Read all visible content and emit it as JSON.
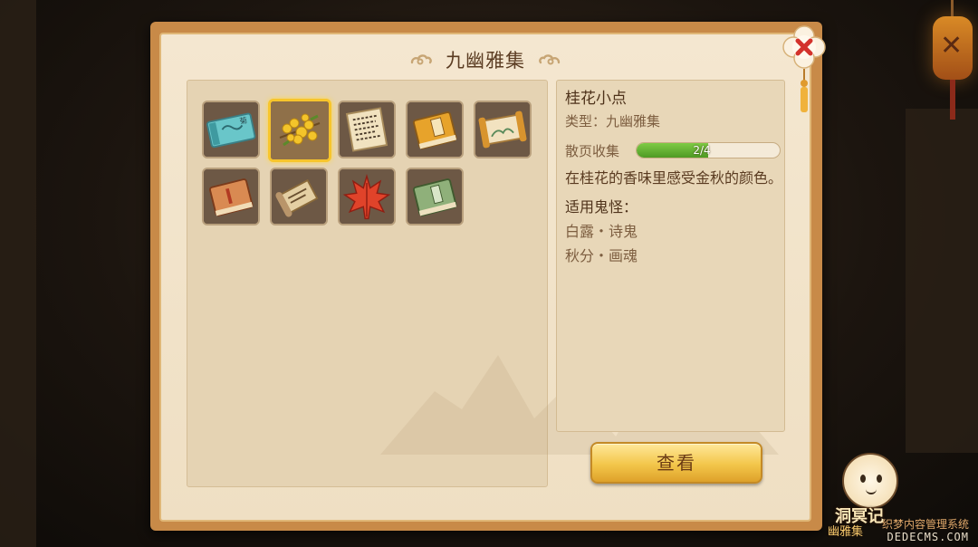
{
  "window": {
    "title": "九幽雅集"
  },
  "items": [
    {
      "name": "item-ticket",
      "icon": "blue-ticket-icon"
    },
    {
      "name": "item-osmanthus",
      "icon": "osmanthus-flower-icon",
      "selected": true
    },
    {
      "name": "item-calligraphy-page",
      "icon": "calligraphy-page-icon"
    },
    {
      "name": "item-yellow-book",
      "icon": "yellow-book-icon"
    },
    {
      "name": "item-scroll",
      "icon": "painting-scroll-icon"
    },
    {
      "name": "item-red-book",
      "icon": "red-book-icon"
    },
    {
      "name": "item-old-scroll",
      "icon": "old-scroll-icon"
    },
    {
      "name": "item-maple-leaf",
      "icon": "maple-leaf-icon"
    },
    {
      "name": "item-green-book",
      "icon": "green-book-icon"
    }
  ],
  "detail": {
    "name": "桂花小点",
    "type_label": "类型：九幽雅集",
    "progress_label": "散页收集",
    "progress_text": "2/4",
    "progress_value": 2,
    "progress_max": 4,
    "description": "在桂花的香味里感受金秋的颜色。",
    "applicable_label": "适用鬼怪：",
    "ghosts": [
      "白露・诗鬼",
      "秋分・画魂"
    ]
  },
  "buttons": {
    "view_label": "查看"
  },
  "mascot": {
    "label": "洞冥记",
    "sublabel": "幽雅集"
  },
  "watermark": {
    "cn": "织梦内容管理系统",
    "en": "DEDECMS.COM"
  },
  "colors": {
    "frame": "#c88a48",
    "parchment": "#f4e7d0",
    "selected_border": "#f7c52c",
    "progress_fill": "#5fae30",
    "button": "#f3c64a"
  }
}
